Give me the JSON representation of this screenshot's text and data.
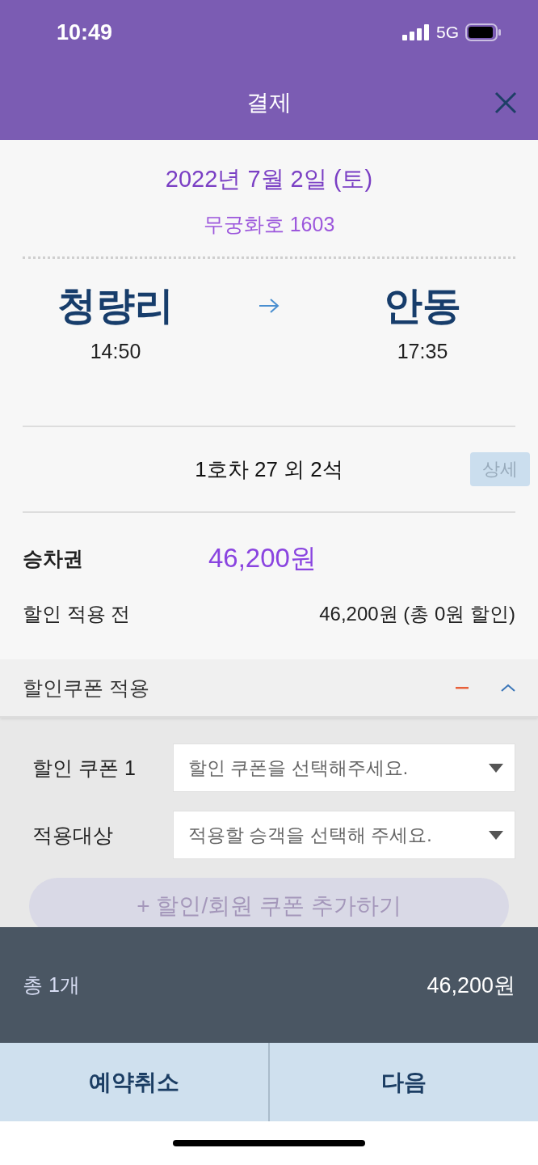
{
  "status_bar": {
    "time": "10:49",
    "network": "5G"
  },
  "header": {
    "title": "결제"
  },
  "trip": {
    "date": "2022년 7월 2일 (토)",
    "train": "무궁화호 1603",
    "departure": {
      "station": "청량리",
      "time": "14:50"
    },
    "arrival": {
      "station": "안동",
      "time": "17:35"
    }
  },
  "seats": {
    "text": "1호차 27 외 2석",
    "detail_button": "상세"
  },
  "fare": {
    "label": "승차권",
    "amount": "46,200원",
    "before_discount_label": "할인 적용 전",
    "before_discount_value": "46,200원 (총 0원 할인)"
  },
  "coupon_section": {
    "title": "할인쿠폰 적용",
    "expanded": true,
    "rows": [
      {
        "label": "할인 쿠폰 1",
        "placeholder": "할인 쿠폰을 선택해주세요."
      },
      {
        "label": "적용대상",
        "placeholder": "적용할 승객을 선택해 주세요."
      }
    ],
    "add_button": {
      "label": "+ 할인/회원 쿠폰 추가하기",
      "disabled": true
    }
  },
  "summary": {
    "count": "총 1개",
    "total": "46,200원"
  },
  "buttons": [
    {
      "label": "예약취소"
    },
    {
      "label": "다음"
    }
  ]
}
